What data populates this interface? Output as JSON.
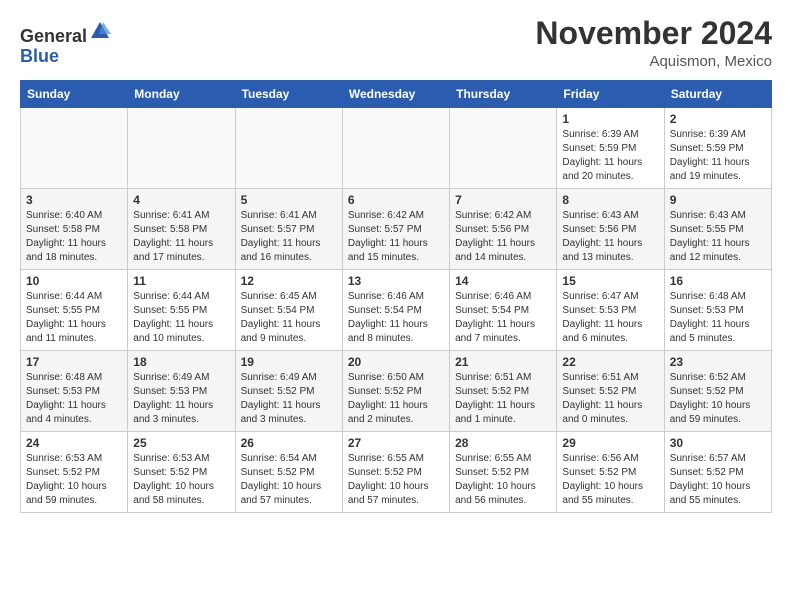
{
  "header": {
    "logo_general": "General",
    "logo_blue": "Blue",
    "month": "November 2024",
    "location": "Aquismon, Mexico"
  },
  "weekdays": [
    "Sunday",
    "Monday",
    "Tuesday",
    "Wednesday",
    "Thursday",
    "Friday",
    "Saturday"
  ],
  "weeks": [
    [
      {
        "day": "",
        "info": ""
      },
      {
        "day": "",
        "info": ""
      },
      {
        "day": "",
        "info": ""
      },
      {
        "day": "",
        "info": ""
      },
      {
        "day": "",
        "info": ""
      },
      {
        "day": "1",
        "info": "Sunrise: 6:39 AM\nSunset: 5:59 PM\nDaylight: 11 hours\nand 20 minutes."
      },
      {
        "day": "2",
        "info": "Sunrise: 6:39 AM\nSunset: 5:59 PM\nDaylight: 11 hours\nand 19 minutes."
      }
    ],
    [
      {
        "day": "3",
        "info": "Sunrise: 6:40 AM\nSunset: 5:58 PM\nDaylight: 11 hours\nand 18 minutes."
      },
      {
        "day": "4",
        "info": "Sunrise: 6:41 AM\nSunset: 5:58 PM\nDaylight: 11 hours\nand 17 minutes."
      },
      {
        "day": "5",
        "info": "Sunrise: 6:41 AM\nSunset: 5:57 PM\nDaylight: 11 hours\nand 16 minutes."
      },
      {
        "day": "6",
        "info": "Sunrise: 6:42 AM\nSunset: 5:57 PM\nDaylight: 11 hours\nand 15 minutes."
      },
      {
        "day": "7",
        "info": "Sunrise: 6:42 AM\nSunset: 5:56 PM\nDaylight: 11 hours\nand 14 minutes."
      },
      {
        "day": "8",
        "info": "Sunrise: 6:43 AM\nSunset: 5:56 PM\nDaylight: 11 hours\nand 13 minutes."
      },
      {
        "day": "9",
        "info": "Sunrise: 6:43 AM\nSunset: 5:55 PM\nDaylight: 11 hours\nand 12 minutes."
      }
    ],
    [
      {
        "day": "10",
        "info": "Sunrise: 6:44 AM\nSunset: 5:55 PM\nDaylight: 11 hours\nand 11 minutes."
      },
      {
        "day": "11",
        "info": "Sunrise: 6:44 AM\nSunset: 5:55 PM\nDaylight: 11 hours\nand 10 minutes."
      },
      {
        "day": "12",
        "info": "Sunrise: 6:45 AM\nSunset: 5:54 PM\nDaylight: 11 hours\nand 9 minutes."
      },
      {
        "day": "13",
        "info": "Sunrise: 6:46 AM\nSunset: 5:54 PM\nDaylight: 11 hours\nand 8 minutes."
      },
      {
        "day": "14",
        "info": "Sunrise: 6:46 AM\nSunset: 5:54 PM\nDaylight: 11 hours\nand 7 minutes."
      },
      {
        "day": "15",
        "info": "Sunrise: 6:47 AM\nSunset: 5:53 PM\nDaylight: 11 hours\nand 6 minutes."
      },
      {
        "day": "16",
        "info": "Sunrise: 6:48 AM\nSunset: 5:53 PM\nDaylight: 11 hours\nand 5 minutes."
      }
    ],
    [
      {
        "day": "17",
        "info": "Sunrise: 6:48 AM\nSunset: 5:53 PM\nDaylight: 11 hours\nand 4 minutes."
      },
      {
        "day": "18",
        "info": "Sunrise: 6:49 AM\nSunset: 5:53 PM\nDaylight: 11 hours\nand 3 minutes."
      },
      {
        "day": "19",
        "info": "Sunrise: 6:49 AM\nSunset: 5:52 PM\nDaylight: 11 hours\nand 3 minutes."
      },
      {
        "day": "20",
        "info": "Sunrise: 6:50 AM\nSunset: 5:52 PM\nDaylight: 11 hours\nand 2 minutes."
      },
      {
        "day": "21",
        "info": "Sunrise: 6:51 AM\nSunset: 5:52 PM\nDaylight: 11 hours\nand 1 minute."
      },
      {
        "day": "22",
        "info": "Sunrise: 6:51 AM\nSunset: 5:52 PM\nDaylight: 11 hours\nand 0 minutes."
      },
      {
        "day": "23",
        "info": "Sunrise: 6:52 AM\nSunset: 5:52 PM\nDaylight: 10 hours\nand 59 minutes."
      }
    ],
    [
      {
        "day": "24",
        "info": "Sunrise: 6:53 AM\nSunset: 5:52 PM\nDaylight: 10 hours\nand 59 minutes."
      },
      {
        "day": "25",
        "info": "Sunrise: 6:53 AM\nSunset: 5:52 PM\nDaylight: 10 hours\nand 58 minutes."
      },
      {
        "day": "26",
        "info": "Sunrise: 6:54 AM\nSunset: 5:52 PM\nDaylight: 10 hours\nand 57 minutes."
      },
      {
        "day": "27",
        "info": "Sunrise: 6:55 AM\nSunset: 5:52 PM\nDaylight: 10 hours\nand 57 minutes."
      },
      {
        "day": "28",
        "info": "Sunrise: 6:55 AM\nSunset: 5:52 PM\nDaylight: 10 hours\nand 56 minutes."
      },
      {
        "day": "29",
        "info": "Sunrise: 6:56 AM\nSunset: 5:52 PM\nDaylight: 10 hours\nand 55 minutes."
      },
      {
        "day": "30",
        "info": "Sunrise: 6:57 AM\nSunset: 5:52 PM\nDaylight: 10 hours\nand 55 minutes."
      }
    ]
  ]
}
